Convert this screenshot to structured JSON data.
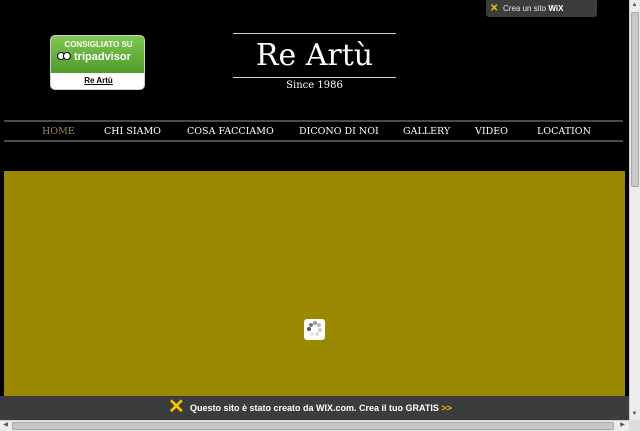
{
  "wix_top": {
    "label": "Crea un sito",
    "brand": "WiX"
  },
  "tripadvisor": {
    "heading": "CONSIGLIATO SU",
    "wordmark": "tripadvisor",
    "link": "Re Artù"
  },
  "logo": {
    "title": "Re Artù",
    "subtitle": "Since 1986"
  },
  "nav": {
    "items": [
      {
        "label": "HOME",
        "active": true
      },
      {
        "label": "CHI SIAMO"
      },
      {
        "label": "COSA FACCIAMO"
      },
      {
        "label": "DICONO DI NOI"
      },
      {
        "label": "GALLERY"
      },
      {
        "label": "VIDEO"
      },
      {
        "label": "LOCATION"
      }
    ]
  },
  "stage": {
    "background": "#998800",
    "loader_icon": "loading-spinner-icon"
  },
  "wix_banner": {
    "text": "Questo sito è stato creato da WIX.com. Crea il tuo GRATIS",
    "arrow": ">>"
  },
  "colors": {
    "page_bg": "#000000",
    "nav_active": "#9a8b57",
    "wix_yellow": "#f5c400",
    "banner_bg": "#3c3c3c"
  }
}
